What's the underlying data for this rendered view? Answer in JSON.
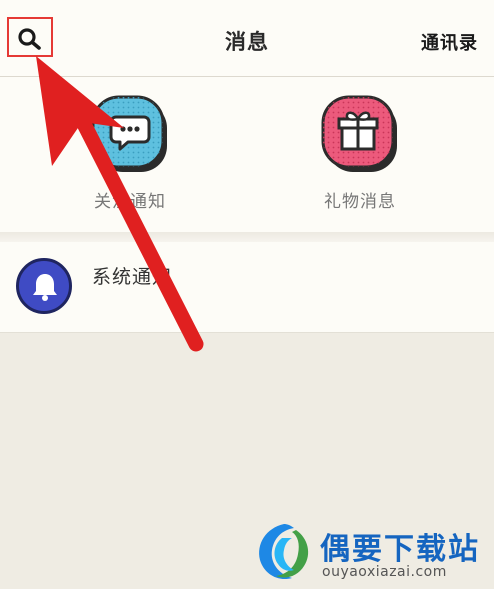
{
  "header": {
    "title": "消息",
    "contacts_label": "通讯录",
    "highlight_color": "#e53935"
  },
  "features": [
    {
      "label": "关注通知",
      "icon": "chat-bubble-icon",
      "color": "#4fb3d3"
    },
    {
      "label": "礼物消息",
      "icon": "gift-icon",
      "color": "#e94c71"
    }
  ],
  "list": [
    {
      "label": "系统通知",
      "icon": "bell-icon",
      "color": "#3f4bc4"
    }
  ],
  "annotation": {
    "arrow_color": "#e02020"
  },
  "watermark": {
    "name": "偶要下载站",
    "url": "ouyaoxiazai.com"
  }
}
